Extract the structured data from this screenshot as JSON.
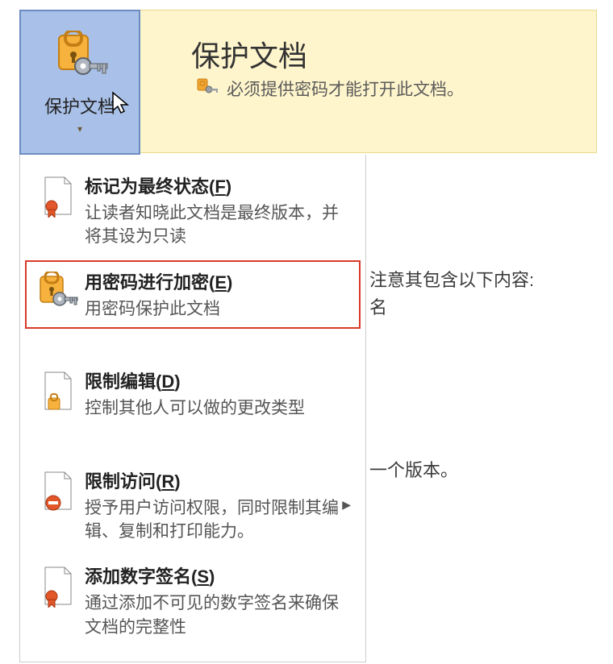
{
  "header": {
    "title": "保护文档",
    "description": "必须提供密码才能打开此文档。"
  },
  "mainButton": {
    "label": "保护文档"
  },
  "menu": [
    {
      "title_pre": "标记为最终状态(",
      "hotkey": "F",
      "title_post": ")",
      "desc": "让读者知晓此文档是最终版本，并将其设为只读",
      "highlighted": false,
      "icon": "doc-ribbon"
    },
    {
      "title_pre": "用密码进行加密(",
      "hotkey": "E",
      "title_post": ")",
      "desc": "用密码保护此文档",
      "highlighted": true,
      "icon": "lock-key"
    },
    {
      "title_pre": "限制编辑(",
      "hotkey": "D",
      "title_post": ")",
      "desc": "控制其他人可以做的更改类型",
      "highlighted": false,
      "icon": "doc-lock"
    },
    {
      "title_pre": "限制访问(",
      "hotkey": "R",
      "title_post": ")",
      "desc": "授予用户访问权限，同时限制其编辑、复制和打印能力。",
      "highlighted": false,
      "icon": "doc-noentry",
      "submenu": true
    },
    {
      "title_pre": "添加数字签名(",
      "hotkey": "S",
      "title_post": ")",
      "desc": "通过添加不可见的数字签名来确保文档的完整性",
      "highlighted": false,
      "icon": "doc-ribbon"
    }
  ],
  "background": {
    "line1": "注意其包含以下内容:",
    "line2": "名",
    "line3": "一个版本。"
  }
}
